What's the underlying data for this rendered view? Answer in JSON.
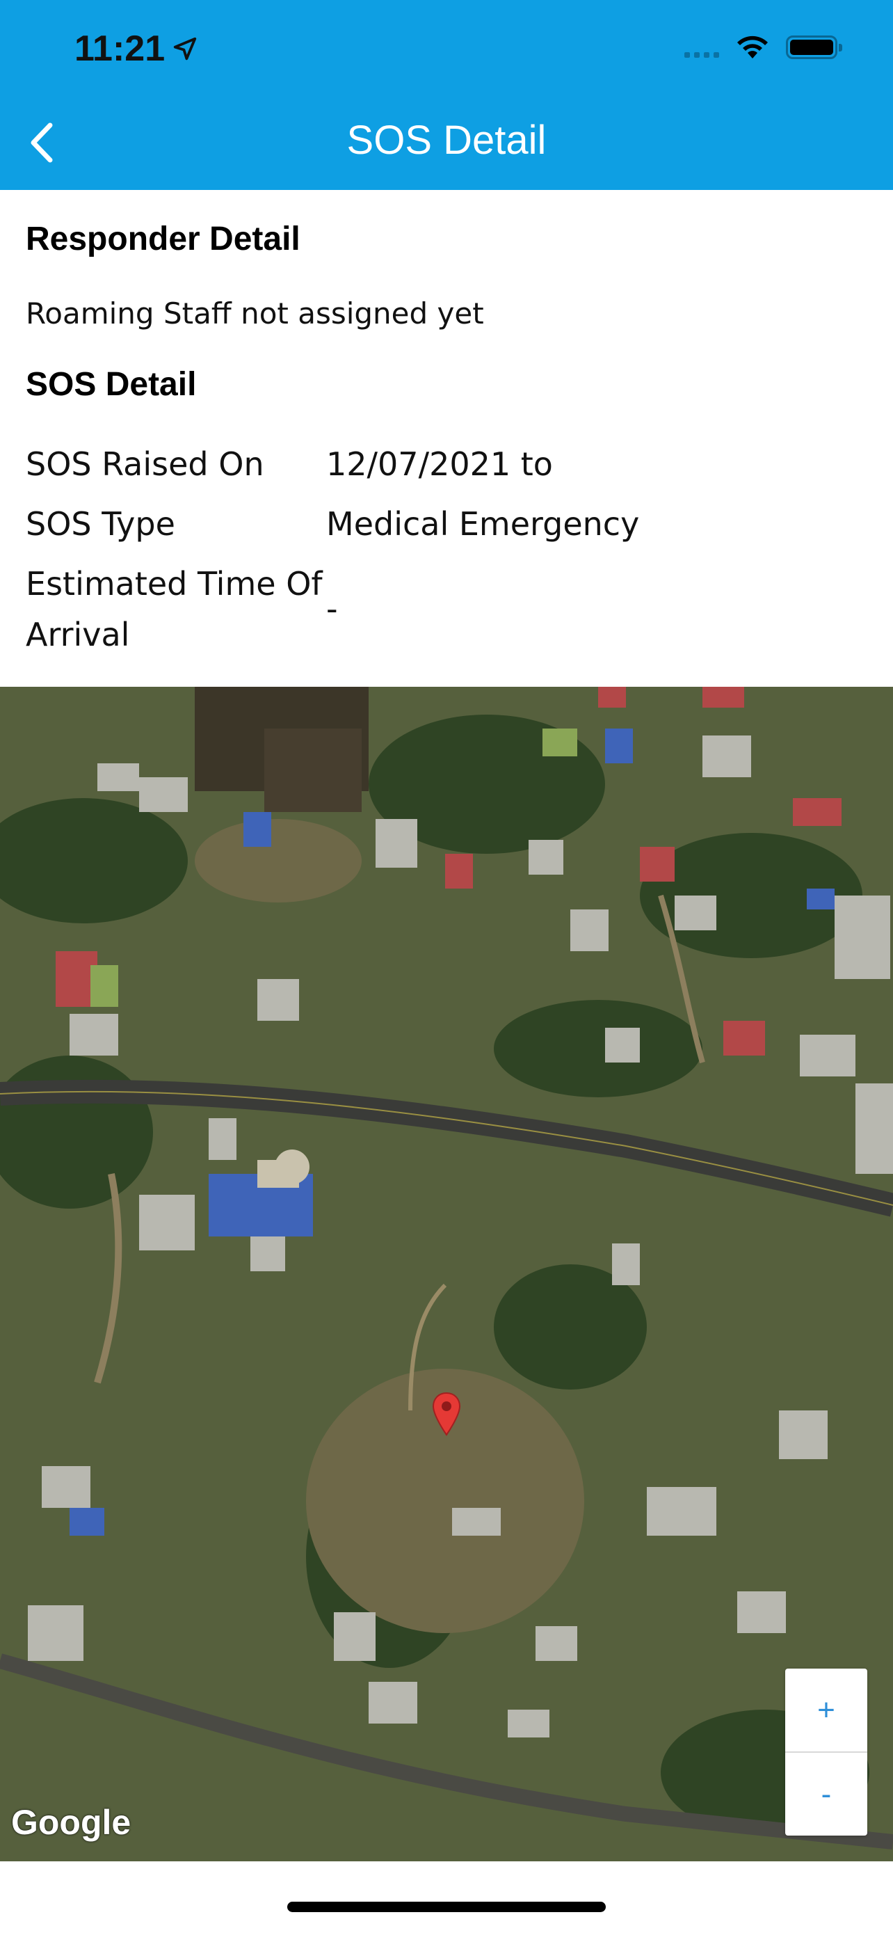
{
  "status_bar": {
    "time": "11:21"
  },
  "header": {
    "title": "SOS Detail",
    "background_color": "#0e9fe3"
  },
  "responder": {
    "heading": "Responder Detail",
    "message": "Roaming Staff not assigned yet"
  },
  "sos": {
    "heading": "SOS Detail",
    "rows": [
      {
        "label": "SOS Raised On",
        "value": "12/07/2021 to"
      },
      {
        "label": "SOS Type",
        "value": "Medical Emergency"
      },
      {
        "label": "Estimated Time Of Arrival",
        "value": "-"
      }
    ]
  },
  "map": {
    "type": "satellite",
    "zoom_in_label": "+",
    "zoom_out_label": "-",
    "attribution": "Google",
    "pin_color": "#e53935"
  },
  "icons": {
    "back": "chevron-left-icon",
    "location": "location-arrow-icon",
    "wifi": "wifi-icon",
    "battery": "battery-icon",
    "pin": "map-pin-icon"
  }
}
